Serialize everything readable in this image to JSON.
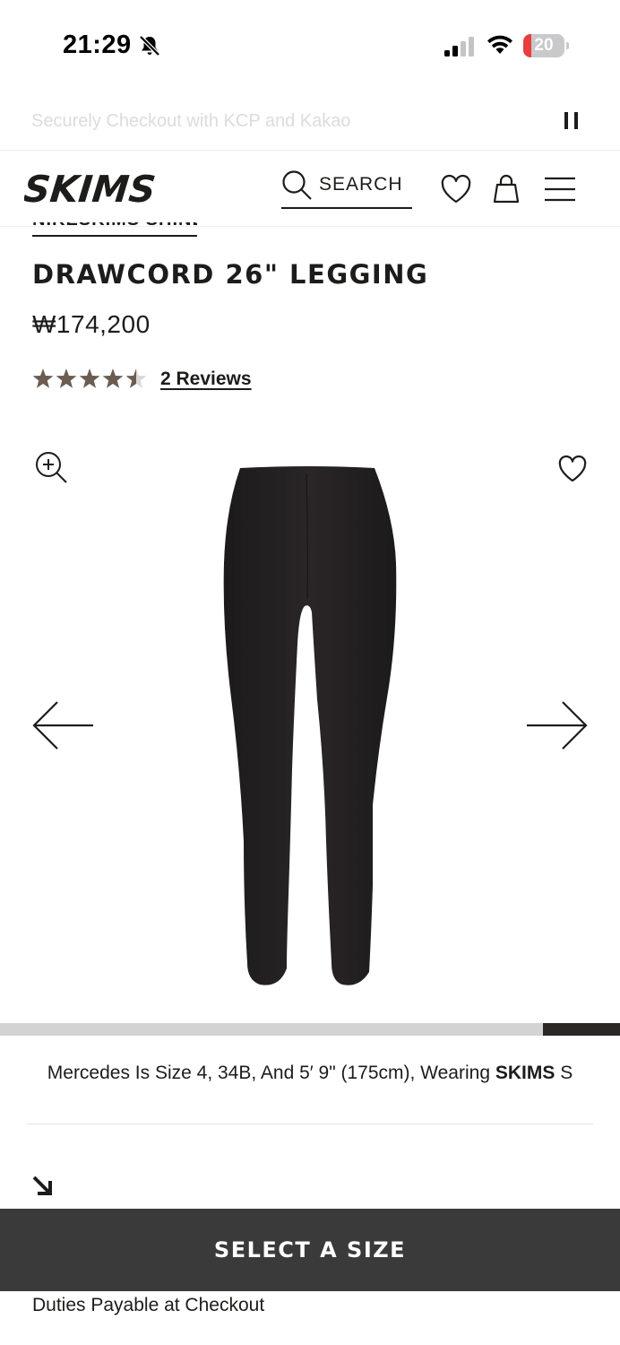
{
  "status_bar": {
    "time": "21:29",
    "battery_level": "20",
    "battery_fraction": 0.2,
    "icons": [
      "bell-off-icon",
      "cellular-signal-icon",
      "wifi-icon",
      "battery-icon"
    ]
  },
  "announcement": {
    "text": "Securely Checkout with KCP and Kakao",
    "pause_icon": "pause-icon"
  },
  "header": {
    "logo_text": "SKIMS",
    "search_label": "SEARCH",
    "icons": [
      "search-icon",
      "heart-icon",
      "shopping-bag-icon",
      "hamburger-menu-icon"
    ]
  },
  "product": {
    "collection": "NIKESKIMS SHINE",
    "title": "DRAWCORD 26\" LEGGING",
    "price": "₩174,200",
    "rating": 4.5,
    "rating_max": 5,
    "reviews_label": "2 Reviews"
  },
  "gallery": {
    "progress_fraction": 0.125,
    "icons": [
      "zoom-in-icon",
      "heart-icon",
      "arrow-left-icon",
      "arrow-right-icon"
    ]
  },
  "model_info": {
    "text": "Mercedes Is Size 4, 34B, And 5′ 9\" (175cm), Wearing ",
    "brand": "SKIMS",
    "size": "S"
  },
  "cta": {
    "select_size_label": "SELECT A SIZE"
  },
  "footer": {
    "duties_text": "Duties Payable at Checkout"
  },
  "colors": {
    "text": "#1e1c1a",
    "star": "#6b5d52",
    "button_bg": "#3b3a3a",
    "battery_low": "#ea3d3d"
  }
}
